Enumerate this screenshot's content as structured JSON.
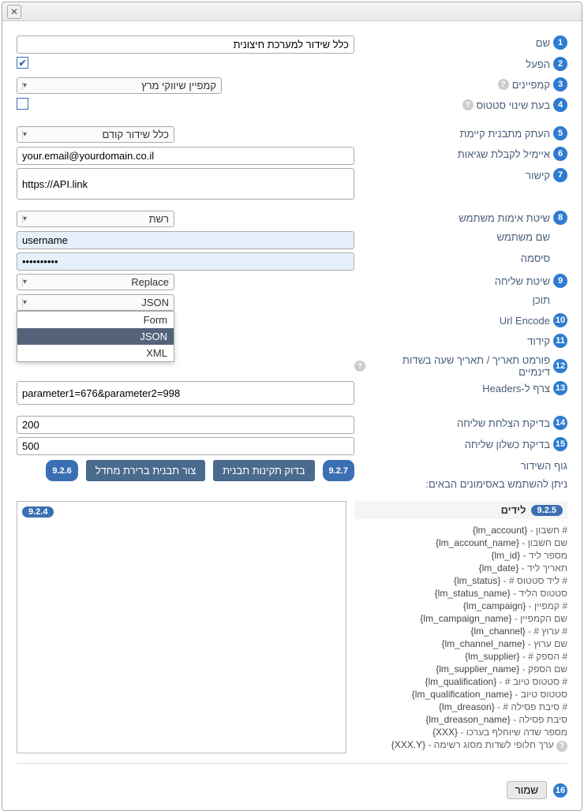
{
  "fields": {
    "name": {
      "badge": "1",
      "label": "שם",
      "value": "כלל שידור למערכת חיצונית"
    },
    "enable": {
      "badge": "2",
      "label": "הפעל",
      "checked": true
    },
    "campaigns": {
      "badge": "3",
      "label": "קמפיינים",
      "value": "קמפיין שיווקי מרץ"
    },
    "status_change": {
      "badge": "4",
      "label": "בעת שינוי סטטוס",
      "checked": false
    },
    "copy_template": {
      "badge": "5",
      "label": "העתק מתבנית קיימת",
      "value": "כלל שידור קודם"
    },
    "error_email": {
      "badge": "6",
      "label": "איימיל לקבלת שגיאות",
      "value": "your.email@yourdomain.co.il"
    },
    "link": {
      "badge": "7",
      "label": "קישור",
      "value": "https://API.link"
    },
    "auth_method": {
      "badge": "8",
      "label": "שיטת אימות משתמש",
      "value": "רשת"
    },
    "username": {
      "label": "שם משתמש",
      "value": "username"
    },
    "password": {
      "label": "סיסמה",
      "value": "••••••••••"
    },
    "send_method": {
      "badge": "9",
      "label": "שיטת שליחה",
      "value": "Replace"
    },
    "content_type": {
      "label": "תוכן",
      "value": "JSON",
      "options": [
        "Form",
        "JSON",
        "XML"
      ]
    },
    "url_encode": {
      "badge": "10",
      "label": "Url Encode"
    },
    "encoding": {
      "badge": "11",
      "label": "קידוד"
    },
    "date_format": {
      "badge": "12",
      "label": "פורמט תאריך / תאריך שעה בשדות דינמיים"
    },
    "headers": {
      "badge": "13",
      "label": "צרף ל-Headers",
      "value": "parameter1=676&parameter2=998"
    },
    "success_check": {
      "badge": "14",
      "label": "בדיקת הצלחת שליחה",
      "value": "200"
    },
    "fail_check": {
      "badge": "15",
      "label": "בדיקת כשלון שליחה",
      "value": "500"
    }
  },
  "body_section": {
    "title": "גוף השידור",
    "subtitle": "ניתן להשתמש באסימונים הבאים:",
    "btn_default": {
      "badge": "9.2.6",
      "label": "צור תבנית ברירת מחדל"
    },
    "btn_validate": {
      "badge": "9.2.7",
      "label": "בדוק תקינות תבנית"
    },
    "editor_badge": "9.2.4"
  },
  "tokens": {
    "badge": "9.2.5",
    "title": "לידים",
    "items": [
      {
        "tk": "{lm_account}",
        "desc": "חשבון #"
      },
      {
        "tk": "{lm_account_name}",
        "desc": "שם חשבון"
      },
      {
        "tk": "{lm_id}",
        "desc": "מספר ליד"
      },
      {
        "tk": "{lm_date}",
        "desc": "תאריך ליד"
      },
      {
        "tk": "{lm_status}",
        "desc": "# ליד סטטוס #"
      },
      {
        "tk": "{lm_status_name}",
        "desc": "סטטוס הליד"
      },
      {
        "tk": "{lm_campaign}",
        "desc": "קמפיין #"
      },
      {
        "tk": "{lm_campaign_name}",
        "desc": "שם הקמפיין"
      },
      {
        "tk": "{lm_channel}",
        "desc": "# ערוץ #"
      },
      {
        "tk": "{lm_channel_name}",
        "desc": "שם ערוץ"
      },
      {
        "tk": "{lm_supplier}",
        "desc": "# הספק #"
      },
      {
        "tk": "{lm_supplier_name}",
        "desc": "שם הספק"
      },
      {
        "tk": "{lm_qualification}",
        "desc": "# סטטוס טיוב #"
      },
      {
        "tk": "{lm_qualification_name}",
        "desc": "סטטוס טיוב"
      },
      {
        "tk": "{lm_dreason}",
        "desc": "# סיבת פסילה #"
      },
      {
        "tk": "{lm_dreason_name}",
        "desc": "סיבת פסילה"
      },
      {
        "tk": "{XXX}",
        "desc": "מספר שדה שיוחלף בערכו"
      },
      {
        "tk": "{XXX.Y}",
        "desc": "ערך חלופי לשדות מסוג רשימה",
        "help": true
      }
    ]
  },
  "footer": {
    "badge": "16",
    "save": "שמור"
  }
}
